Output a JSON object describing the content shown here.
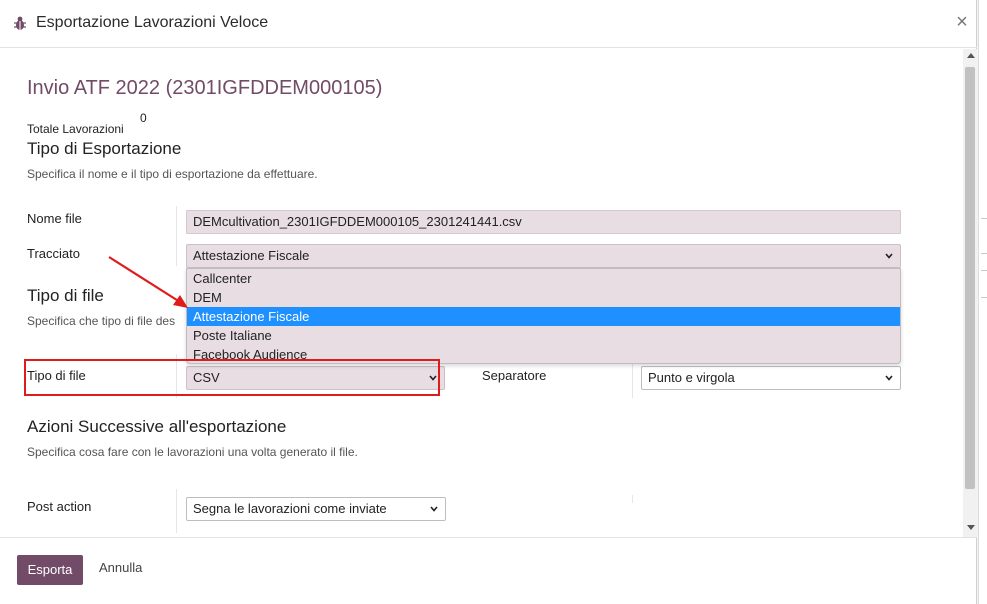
{
  "modal": {
    "title": "Esportazione Lavorazioni Veloce",
    "heading": "Invio ATF 2022 (2301IGFDDEM000105)",
    "totale_label": "Totale Lavorazioni",
    "totale_value": "0",
    "tipo_esportazione": {
      "title": "Tipo di Esportazione",
      "desc": "Specifica il nome e il tipo di esportazione da effettuare.",
      "nome_file_label": "Nome file",
      "nome_file_value": "DEMcultivation_2301IGFDDEM000105_2301241441.csv",
      "tracciato_label": "Tracciato",
      "tracciato_value": "Attestazione Fiscale",
      "tracciato_options": [
        "Callcenter",
        "DEM",
        "Attestazione Fiscale",
        "Poste Italiane",
        "Facebook Audience"
      ]
    },
    "tipo_file_section": {
      "title": "Tipo di file",
      "desc": "Specifica che tipo di file des",
      "tipo_file_label": "Tipo di file",
      "tipo_file_value": "CSV",
      "separatore_label": "Separatore",
      "separatore_value": "Punto e virgola"
    },
    "azioni": {
      "title": "Azioni Successive all'esportazione",
      "desc": "Specifica cosa fare con le lavorazioni una volta generato il file.",
      "post_action_label": "Post action",
      "post_action_value": "Segna le lavorazioni come inviate"
    },
    "footer": {
      "export_label": "Esporta",
      "cancel_label": "Annulla"
    }
  },
  "colors": {
    "brand": "#714b67",
    "field_fill": "#e8dde3",
    "selection": "#1e90ff",
    "annotation": "#e01b1b"
  }
}
